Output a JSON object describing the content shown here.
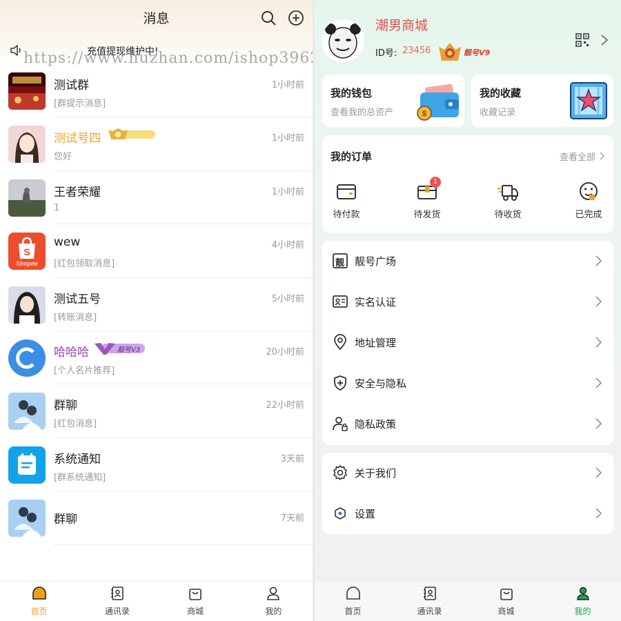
{
  "left": {
    "title": "消息",
    "notice": "充值提现维护中!",
    "watermark": "https://www.huzhan.com/ishop39622",
    "chats": [
      {
        "name": "测试群",
        "time": "1小时前",
        "preview": "[群提示消息]"
      },
      {
        "name": "测试号四",
        "time": "1小时前",
        "preview": "您好"
      },
      {
        "name": "王者荣耀",
        "time": "1小时前",
        "preview": "1"
      },
      {
        "name": "wew",
        "time": "4小时前",
        "preview": "[红包领取消息]"
      },
      {
        "name": "测试五号",
        "time": "5小时前",
        "preview": "[转账消息]"
      },
      {
        "name": "哈哈哈",
        "time": "20小时前",
        "preview": "[个人名片推荐]"
      },
      {
        "name": "群聊",
        "time": "22小时前",
        "preview": "[红包消息]"
      },
      {
        "name": "系统通知",
        "time": "3天前",
        "preview": "[群系统通知]"
      },
      {
        "name": "群聊",
        "time": "7天前",
        "preview": ""
      }
    ],
    "badge_v3": "靓号V3",
    "shopee_label": "Shopee",
    "tabs": [
      {
        "label": "首页"
      },
      {
        "label": "通讯录"
      },
      {
        "label": "商城"
      },
      {
        "label": "我的"
      }
    ]
  },
  "right": {
    "profile": {
      "name": "潮男商城",
      "id_label": "ID号:",
      "id_value": "23456",
      "badge": "靓号V9"
    },
    "wallet": {
      "title": "我的钱包",
      "sub": "查看我的总资产"
    },
    "favorites": {
      "title": "我的收藏",
      "sub": "收藏记录"
    },
    "orders": {
      "title": "我的订单",
      "view_all": "查看全部",
      "items": [
        {
          "label": "待付款"
        },
        {
          "label": "待发货",
          "badge": "1"
        },
        {
          "label": "待收货"
        },
        {
          "label": "已完成"
        }
      ]
    },
    "menu1": [
      {
        "label": "靓号广场",
        "icon": "liang-icon"
      },
      {
        "label": "实名认证",
        "icon": "id-card-icon"
      },
      {
        "label": "地址管理",
        "icon": "location-icon"
      },
      {
        "label": "安全与隐私",
        "icon": "shield-icon"
      },
      {
        "label": "隐私政策",
        "icon": "user-lock-icon"
      }
    ],
    "menu2": [
      {
        "label": "关于我们",
        "icon": "gear-icon"
      },
      {
        "label": "设置",
        "icon": "settings-hex-icon"
      }
    ],
    "liang_char": "靓",
    "tabs": [
      {
        "label": "首页"
      },
      {
        "label": "通讯录"
      },
      {
        "label": "商城"
      },
      {
        "label": "我的"
      }
    ]
  },
  "colors": {
    "accent_orange": "#f0a020",
    "accent_green": "#1aa64a",
    "vip_gold": "#e8b53a",
    "vip_purple": "#8e44ad",
    "name_red": "#d9534f"
  }
}
